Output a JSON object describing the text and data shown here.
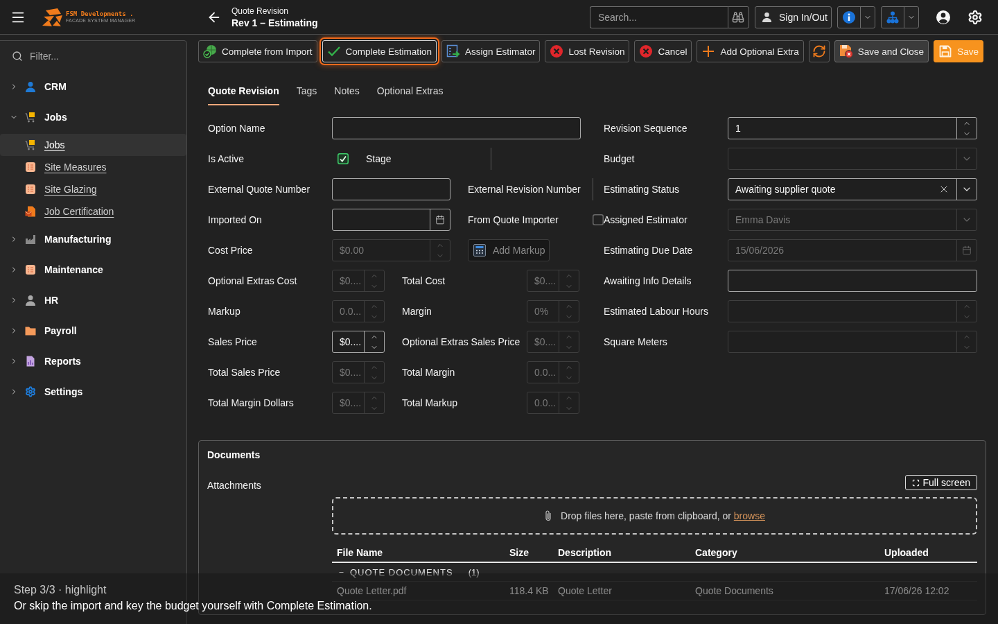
{
  "header": {
    "logo": {
      "name": "FSM Developments .",
      "tagline": "FACADE SYSTEM MANAGER"
    },
    "title": "Quote Revision",
    "subtitle": "Rev 1 – Estimating",
    "search": {
      "placeholder": "Search..."
    },
    "sign_in_button": "Sign In/Out"
  },
  "sidebar": {
    "filter": {
      "placeholder": "Filter..."
    },
    "items": [
      {
        "label": "CRM",
        "expanded": false
      },
      {
        "label": "Jobs",
        "expanded": true,
        "children": [
          {
            "label": "Jobs",
            "selected": true
          },
          {
            "label": "Site Measures",
            "selected": false
          },
          {
            "label": "Site Glazing",
            "selected": false
          },
          {
            "label": "Job Certification",
            "selected": false
          }
        ]
      },
      {
        "label": "Manufacturing",
        "expanded": false
      },
      {
        "label": "Maintenance",
        "expanded": false
      },
      {
        "label": "HR",
        "expanded": false
      },
      {
        "label": "Payroll",
        "expanded": false
      },
      {
        "label": "Reports",
        "expanded": false
      },
      {
        "label": "Settings",
        "expanded": false
      }
    ]
  },
  "toolbar": [
    {
      "kind": "default",
      "label": "Complete from Import",
      "highlighted": false
    },
    {
      "kind": "default",
      "label": "Complete Estimation",
      "highlighted": true
    },
    {
      "kind": "default",
      "label": "Assign Estimator",
      "highlighted": false
    },
    {
      "kind": "default",
      "label": "Lost Revision",
      "highlighted": false
    },
    {
      "kind": "default",
      "label": "Cancel",
      "highlighted": false
    },
    {
      "kind": "default",
      "label": "Add Optional Extra",
      "highlighted": false
    },
    {
      "kind": "icon",
      "highlighted": false
    },
    {
      "kind": "filled",
      "label": "Save and Close",
      "highlighted": false
    },
    {
      "kind": "primary",
      "label": "Save",
      "highlighted": false
    }
  ],
  "tabs": [
    {
      "label": "Quote Revision",
      "selected": true
    },
    {
      "label": "Tags",
      "selected": false
    },
    {
      "label": "Notes",
      "selected": false
    },
    {
      "label": "Optional Extras",
      "selected": false
    }
  ],
  "form": {
    "left_rows": [
      {
        "kind": "wide",
        "cells": [
          {
            "label": "Option Name",
            "field": {
              "kind": "text",
              "disabled": false
            }
          }
        ]
      },
      {
        "kind": "pair",
        "cells": [
          {
            "label": "Is Active",
            "field": {
              "kind": "checkbox",
              "checked": true
            }
          },
          {
            "label": "Stage"
          }
        ]
      },
      {
        "kind": "pair",
        "cells": [
          {
            "label": "External Quote Number",
            "field": {
              "kind": "text",
              "disabled": false
            }
          },
          {
            "label": "External Revision Number"
          }
        ]
      },
      {
        "kind": "pair",
        "cells": [
          {
            "label": "Imported On",
            "field": {
              "kind": "date",
              "disabled": false
            }
          },
          {
            "label": "From Quote Importer",
            "field": {
              "kind": "checkbox",
              "checked": false
            }
          }
        ]
      },
      {
        "kind": "pair",
        "cells": [
          {
            "label": "Cost Price",
            "field": {
              "kind": "spin",
              "value": "$0.00",
              "disabled": true
            }
          },
          {
            "field": {
              "kind": "button",
              "label": "Add Markup",
              "disabled": true
            }
          }
        ]
      },
      {
        "kind": "compact",
        "cells": [
          {
            "label": "Optional Extras Cost",
            "field": {
              "kind": "spin",
              "value": "$0....",
              "disabled": true
            }
          },
          {
            "label": "Total Cost",
            "field": {
              "kind": "spin",
              "value": "$0....",
              "disabled": true
            }
          }
        ]
      },
      {
        "kind": "compact",
        "cells": [
          {
            "label": "Markup",
            "field": {
              "kind": "spin",
              "value": "0.0...",
              "disabled": true
            }
          },
          {
            "label": "Margin",
            "field": {
              "kind": "spin",
              "value": "0%",
              "disabled": true
            }
          }
        ]
      },
      {
        "kind": "compact",
        "cells": [
          {
            "label": "Sales Price",
            "field": {
              "kind": "spin",
              "value": "$0....",
              "disabled": false
            }
          },
          {
            "label": "Optional Extras Sales Price",
            "field": {
              "kind": "spin",
              "value": "$0....",
              "disabled": true
            }
          }
        ]
      },
      {
        "kind": "compact",
        "cells": [
          {
            "label": "Total Sales Price",
            "field": {
              "kind": "spin",
              "value": "$0....",
              "disabled": true
            }
          },
          {
            "label": "Total Margin",
            "field": {
              "kind": "spin",
              "value": "0.0...",
              "disabled": true
            }
          }
        ]
      },
      {
        "kind": "compact",
        "cells": [
          {
            "label": "Total Margin Dollars",
            "field": {
              "kind": "spin",
              "value": "$0....",
              "disabled": true
            }
          },
          {
            "label": "Total Markup",
            "field": {
              "kind": "spin",
              "value": "0.0...",
              "disabled": true
            }
          }
        ]
      }
    ],
    "right_rows": [
      {
        "label": "Revision Sequence",
        "field": {
          "kind": "spin",
          "value": "1",
          "disabled": false
        }
      },
      {
        "label": "Budget",
        "field": {
          "kind": "select",
          "disabled": true
        }
      },
      {
        "label": "Estimating Status",
        "field": {
          "kind": "select",
          "value": "Awaiting supplier quote",
          "disabled": false,
          "clearable": true
        }
      },
      {
        "label": "Assigned Estimator",
        "field": {
          "kind": "select",
          "value": "Emma Davis",
          "disabled": true
        }
      },
      {
        "label": "Estimating Due Date",
        "field": {
          "kind": "date",
          "value": "15/06/2026",
          "disabled": true
        }
      },
      {
        "label": "Awaiting Info Details",
        "field": {
          "kind": "text",
          "disabled": false
        }
      },
      {
        "label": "Estimated Labour Hours",
        "field": {
          "kind": "spin",
          "disabled": true
        }
      },
      {
        "label": "Square Meters",
        "field": {
          "kind": "spin",
          "disabled": true
        }
      }
    ]
  },
  "documents": {
    "title": "Documents",
    "attachments_label": "Attachments",
    "full_screen_button": "Full screen",
    "drop_zone": {
      "text": "Drop files here, paste from clipboard, or",
      "link": "browse"
    },
    "table": {
      "columns": [
        "File Name",
        "Size",
        "Description",
        "Category",
        "Uploaded"
      ],
      "groups": [
        {
          "label": "QUOTE DOCUMENTS",
          "count": "(1)",
          "expanded": true,
          "rows": [
            [
              "Quote Letter.pdf",
              "118.4 KB",
              "Quote Letter",
              "Quote Documents",
              "17/06/26 12:02"
            ]
          ]
        }
      ]
    }
  },
  "caption": {
    "step": "Step 3/3 · highlight",
    "text": "Or skip the import and key the budget yourself with Complete Estimation."
  }
}
